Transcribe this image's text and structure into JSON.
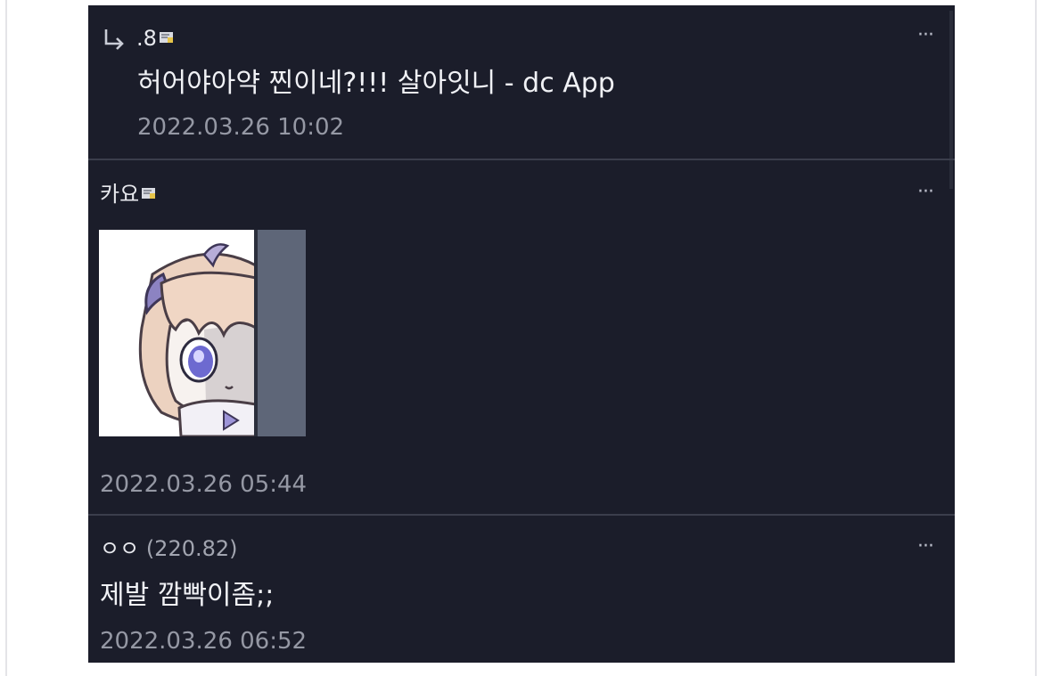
{
  "comments": [
    {
      "nick": ".8",
      "text": "허어야아약 찐이네?!!! 살아잇니 - dc App",
      "time": "2022.03.26 10:02",
      "more": "···"
    },
    {
      "nick": "카요",
      "time": "2022.03.26 05:44",
      "more": "···",
      "sticker_icon": "peeking-anime-girl-sticker"
    },
    {
      "nick": "ㅇㅇ",
      "ip": "(220.82)",
      "text": "제발 깜빡이좀;;",
      "time": "2022.03.26 06:52",
      "more": "···"
    }
  ],
  "icons": {
    "reply": "reply-arrow-icon",
    "badge": "fixed-nick-badge-icon",
    "more": "more-options-icon"
  },
  "colors": {
    "background": "#1b1d2a",
    "divider": "#3b3e4c",
    "text": "#f0f1f5",
    "meta": "#9598a4",
    "badge": "#e6c44a"
  }
}
